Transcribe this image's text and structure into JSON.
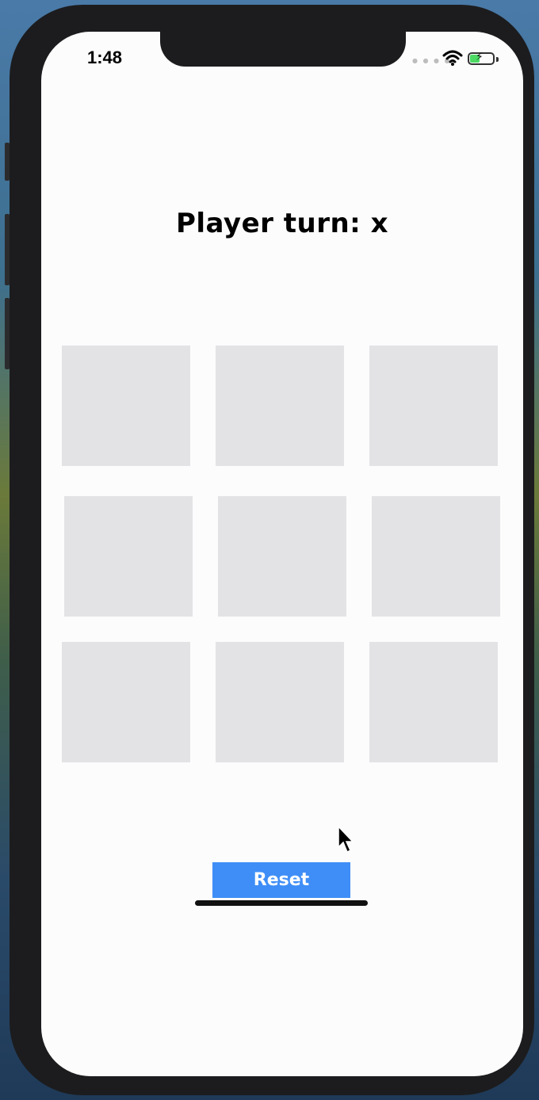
{
  "status_bar": {
    "time": "1:48"
  },
  "game": {
    "title": "Player turn: x",
    "cells": [
      "",
      "",
      "",
      "",
      "",
      "",
      "",
      "",
      ""
    ],
    "reset_label": "Reset"
  },
  "colors": {
    "cell": "#e3e3e6",
    "reset_button": "#3f8ef7",
    "battery": "#4cd964"
  },
  "icons": [
    "wifi-icon",
    "battery-icon",
    "signal-icon",
    "mouse-cursor-icon"
  ]
}
